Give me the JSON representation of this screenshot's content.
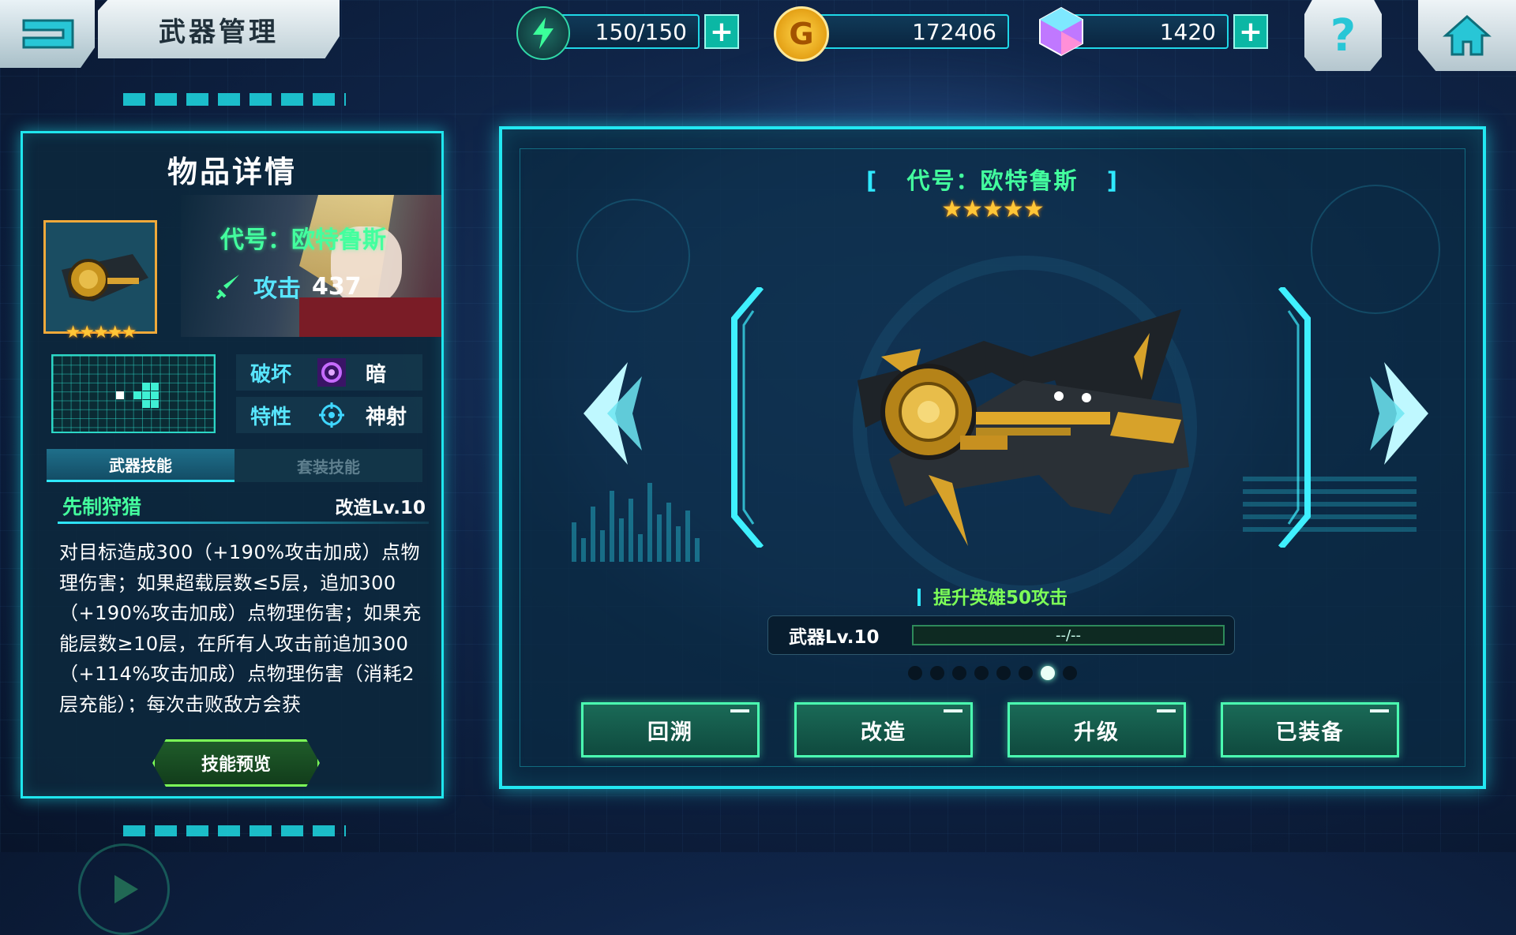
{
  "header": {
    "title": "武器管理",
    "energy": "150/150",
    "gold": "172406",
    "crystal": "1420"
  },
  "detail": {
    "panel_title": "物品详情",
    "weapon_name": "代号：欧特鲁斯",
    "attack_label": "攻击",
    "attack_value": "437",
    "stars": 5,
    "destroy_label": "破坏",
    "destroy_value": "暗",
    "trait_label": "特性",
    "trait_value": "神射",
    "tabs": [
      "武器技能",
      "套装技能"
    ],
    "skill_name": "先制狩猎",
    "skill_level": "改造Lv.10",
    "skill_desc": "对目标造成300（+190%攻击加成）点物理伤害；如果超载层数≤5层，追加300（+190%攻击加成）点物理伤害；如果充能层数≥10层，在所有人攻击前追加300（+114%攻击加成）点物理伤害（消耗2层充能）；每次击败敌方会获",
    "preview_button": "技能预览"
  },
  "showcase": {
    "code_name": "代号：欧特鲁斯",
    "stars": 5,
    "bonus_text": "提升英雄50攻击",
    "weapon_level_label": "武器Lv.10",
    "exp_text": "--/--",
    "page_count": 8,
    "active_page": 7,
    "buttons": [
      "回溯",
      "改造",
      "升级",
      "已装备"
    ]
  },
  "colors": {
    "accent_cyan": "#22e8f2",
    "name_green": "#43ff9e",
    "star_gold": "#ffc637"
  },
  "icons": [
    "back-arrow-icon",
    "lightning-icon",
    "gold-coin-icon",
    "crystal-icon",
    "plus-icon",
    "help-icon",
    "home-icon",
    "sword-icon",
    "dark-element-icon",
    "crosshair-icon",
    "arrow-left-icon",
    "arrow-right-icon",
    "play-icon"
  ]
}
